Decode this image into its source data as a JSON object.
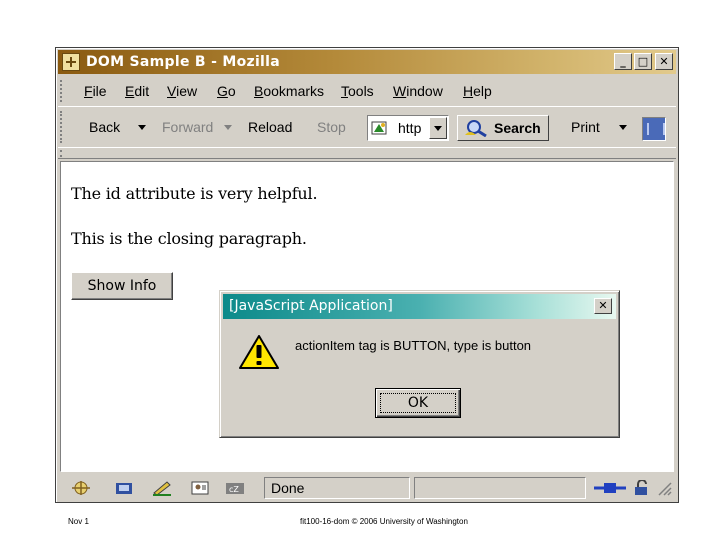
{
  "window": {
    "title": "DOM Sample B - Mozilla",
    "controls": {
      "minimize": "_",
      "maximize": "□",
      "close": "✕"
    }
  },
  "menu": {
    "items": [
      "File",
      "Edit",
      "View",
      "Go",
      "Bookmarks",
      "Tools",
      "Window",
      "Help"
    ]
  },
  "nav": {
    "back": "Back",
    "forward": "Forward",
    "reload": "Reload",
    "stop": "Stop",
    "url_value": "http",
    "search": "Search",
    "print": "Print"
  },
  "page": {
    "paragraph1": "The id attribute is very helpful.",
    "paragraph2": "This is the closing paragraph.",
    "show_info_button": "Show Info"
  },
  "dialog": {
    "title": "[JavaScript Application]",
    "close": "✕",
    "message": "actionItem tag is BUTTON, type is button",
    "ok": "OK"
  },
  "status": {
    "text": "Done"
  },
  "footer": {
    "left": "Nov 1",
    "center": "fit100-16-dom © 2006 University of Washington"
  },
  "colors": {
    "titlebar": "#b48a3a",
    "dialog_titlebar": "#0c8a8a",
    "chrome": "#d4d0c8"
  }
}
